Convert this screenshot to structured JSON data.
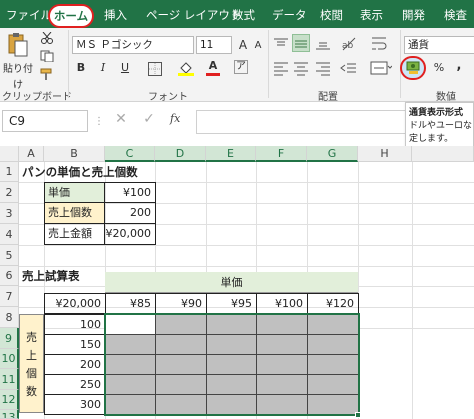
{
  "tabs": [
    "ファイル",
    "ホーム",
    "挿入",
    "ページ レイアウト",
    "数式",
    "データ",
    "校閲",
    "表示",
    "開発",
    "検査"
  ],
  "ribbon": {
    "clipboard": {
      "paste": "貼り付け",
      "group": "クリップボード"
    },
    "font": {
      "name": "ＭＳ Ｐゴシック",
      "size": "11",
      "group": "フォント",
      "bold": "B",
      "italic": "I",
      "underline": "U",
      "size_up": "A",
      "size_down": "A",
      "font_color": "A",
      "ruby": "ア"
    },
    "align": {
      "group": "配置"
    },
    "number": {
      "format": "通貨",
      "group": "数値",
      "percent": "%",
      "comma": ","
    }
  },
  "namebox": "C9",
  "fx": "fx",
  "tooltip": {
    "title": "通貨表示形式",
    "line1": "ドルやユーロなど",
    "line2": "定します。"
  },
  "columns": [
    "A",
    "B",
    "C",
    "D",
    "E",
    "F",
    "G",
    "H"
  ],
  "rows": [
    "1",
    "2",
    "3",
    "4",
    "5",
    "6",
    "7",
    "8",
    "9",
    "10",
    "11",
    "12",
    "13"
  ],
  "sheet": {
    "title1": "パンの単価と売上個数",
    "t1_label1": "単価",
    "t1_val1": "¥100",
    "t1_label2": "売上個数",
    "t1_val2": "200",
    "t1_label3": "売上金額",
    "t1_val3": "¥20,000",
    "title2": "売上試算表",
    "header_unit": "単価",
    "corner": "¥20,000",
    "prices": [
      "¥85",
      "¥90",
      "¥95",
      "¥100",
      "¥120"
    ],
    "side_label": [
      "売",
      "上",
      "個",
      "数"
    ],
    "qty": [
      "100",
      "150",
      "200",
      "250",
      "300"
    ]
  },
  "colors": {
    "excel_green": "#217346",
    "gray_fill": "#c0c0c0",
    "green_fill": "#e2efda",
    "yellow_fill": "#fff2cc",
    "highlight": "#e02020"
  }
}
